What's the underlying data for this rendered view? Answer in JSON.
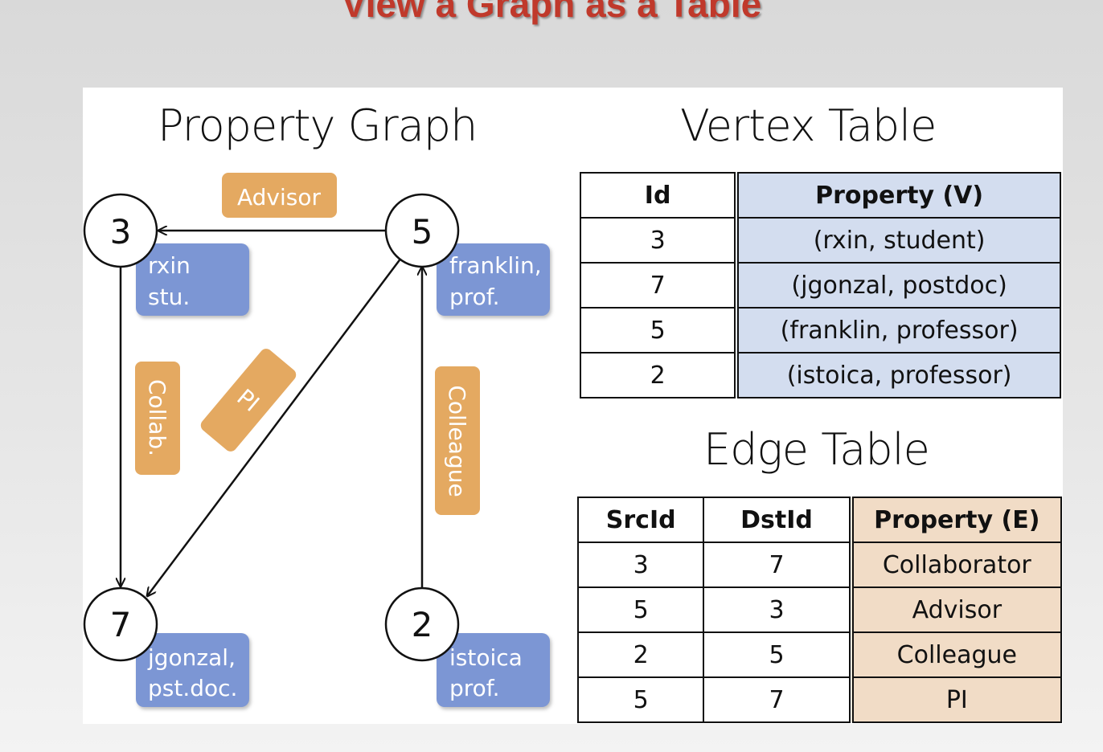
{
  "slide_title": "View a Graph as a Table",
  "graph": {
    "heading": "Property Graph",
    "vertices": [
      {
        "id": "3",
        "labels": [
          "rxin",
          "stu."
        ]
      },
      {
        "id": "5",
        "labels": [
          "franklin,",
          "prof."
        ]
      },
      {
        "id": "7",
        "labels": [
          "jgonzal,",
          "pst.doc."
        ]
      },
      {
        "id": "2",
        "labels": [
          "istoica",
          "prof."
        ]
      }
    ],
    "edges": [
      {
        "from": "5",
        "to": "3",
        "label": "Advisor"
      },
      {
        "from": "3",
        "to": "7",
        "label": "Collab."
      },
      {
        "from": "5",
        "to": "7",
        "label": "PI"
      },
      {
        "from": "2",
        "to": "5",
        "label": "Colleague"
      }
    ],
    "colors": {
      "vertex_property": "#7c96d4",
      "edge_property": "#e4a961"
    }
  },
  "vertex_table": {
    "heading": "Vertex Table",
    "columns": [
      "Id",
      "Property (V)"
    ],
    "rows": [
      [
        "3",
        "(rxin, student)"
      ],
      [
        "7",
        "(jgonzal, postdoc)"
      ],
      [
        "5",
        "(franklin, professor)"
      ],
      [
        "2",
        "(istoica, professor)"
      ]
    ]
  },
  "edge_table": {
    "heading": "Edge Table",
    "columns": [
      "SrcId",
      "DstId",
      "Property (E)"
    ],
    "rows": [
      [
        "3",
        "7",
        "Collaborator"
      ],
      [
        "5",
        "3",
        "Advisor"
      ],
      [
        "2",
        "5",
        "Colleague"
      ],
      [
        "5",
        "7",
        "PI"
      ]
    ]
  }
}
